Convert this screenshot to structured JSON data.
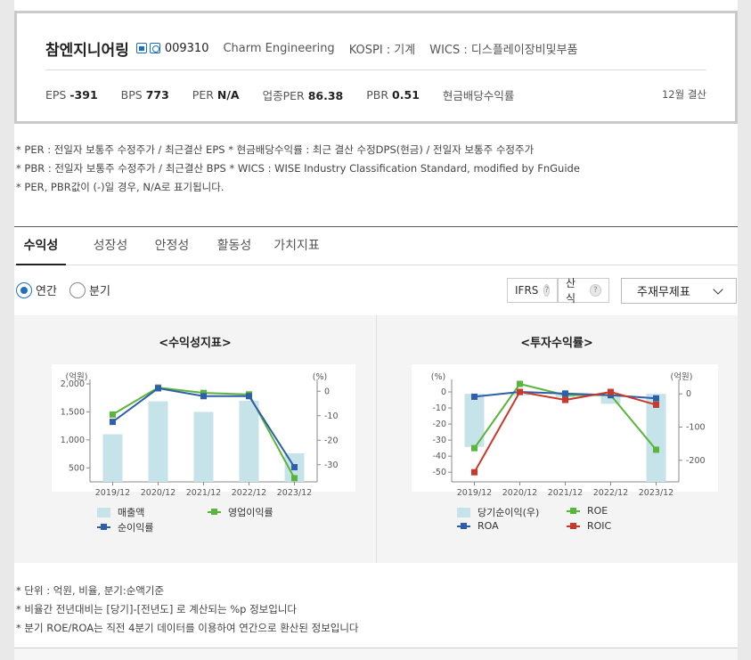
{
  "company": {
    "name": "참엔지니어링",
    "code": "009310",
    "english_name": "Charm Engineering",
    "market": "KOSPI : 기계",
    "wics": "WICS : 디스플레이장비및부품",
    "icons": [
      "home-icon",
      "ir-icon"
    ]
  },
  "metrics": [
    {
      "label": "EPS",
      "value": "-391"
    },
    {
      "label": "BPS",
      "value": "773"
    },
    {
      "label": "PER",
      "value": "N/A"
    },
    {
      "label": "업종PER",
      "value": "86.38"
    },
    {
      "label": "PBR",
      "value": "0.51"
    },
    {
      "label": "현금배당수익률",
      "value": ""
    }
  ],
  "settlement": "12월 결산",
  "notes": [
    "* PER : 전일자 보통주 수정주가 / 최근결산 EPS * 현금배당수익률 : 최근 결산 수정DPS(현금) / 전일자 보통주 수정주가",
    "* PBR : 전일자 보통주 수정주가 / 최근결산 BPS * WICS : WISE Industry Classification Standard, modified by FnGuide",
    "* PER, PBR값이 (-)일 경우, N/A로 표기됩니다."
  ],
  "tabs": [
    "수익성",
    "성장성",
    "안정성",
    "활동성",
    "가치지표"
  ],
  "active_tab": 0,
  "period_options": [
    "연간",
    "분기"
  ],
  "selected_period": "연간",
  "buttons": {
    "ifrs": "IFRS",
    "formula": "산식",
    "help": "?"
  },
  "statement_select": "주재무제표",
  "colors": {
    "bar": "#c7e3ea",
    "green": "#5ab53c",
    "blue": "#2e5fa8",
    "red": "#c8392b",
    "accent": "#1f6fbf"
  },
  "chart_data": [
    {
      "type": "bar+line",
      "title": "<수익성지표>",
      "categories": [
        "2019/12",
        "2020/12",
        "2021/12",
        "2022/12",
        "2023/12"
      ],
      "left_axis": {
        "label": "(억원)",
        "ticks": [
          "2,000",
          "1,500",
          "1,000",
          "500"
        ],
        "ylim": [
          250,
          2000
        ]
      },
      "right_axis": {
        "label": "(%)",
        "ticks": [
          "0",
          "-10",
          "-20",
          "-30"
        ],
        "ylim": [
          -37,
          3
        ]
      },
      "bars": {
        "name": "매출액",
        "axis": "left",
        "values": [
          1100,
          1690,
          1500,
          1700,
          760
        ]
      },
      "series": [
        {
          "name": "영업이익률",
          "axis": "right",
          "color": "#5ab53c",
          "values": [
            -9.5,
            1.5,
            -0.7,
            -1.3,
            -35.5
          ]
        },
        {
          "name": "순이익률",
          "axis": "right",
          "color": "#2e5fa8",
          "values": [
            -12.5,
            1.2,
            -2.0,
            -2.0,
            -31.0
          ]
        }
      ],
      "legend": [
        "매출액",
        "영업이익률",
        "순이익률"
      ]
    },
    {
      "type": "bar+line",
      "title": "<투자수익률>",
      "categories": [
        "2019/12",
        "2020/12",
        "2021/12",
        "2022/12",
        "2023/12"
      ],
      "left_axis": {
        "label": "(%)",
        "ticks": [
          "0",
          "-10",
          "-20",
          "-30",
          "-40",
          "-50"
        ],
        "ylim": [
          -56,
          5
        ]
      },
      "right_axis": {
        "label": "(억원)",
        "ticks": [
          "0",
          "-100",
          "-200"
        ],
        "ylim": [
          -265,
          30
        ]
      },
      "bars": {
        "name": "당기순이익(우)",
        "axis": "right",
        "values": [
          -160,
          -5,
          -10,
          -30,
          -265
        ]
      },
      "series": [
        {
          "name": "ROE",
          "axis": "left",
          "color": "#5ab53c",
          "values": [
            -35,
            5,
            -2,
            -2,
            -36
          ]
        },
        {
          "name": "ROA",
          "axis": "left",
          "color": "#2e5fa8",
          "values": [
            -3,
            0,
            -1,
            -2,
            -4
          ]
        },
        {
          "name": "ROIC",
          "axis": "left",
          "color": "#c8392b",
          "values": [
            -50,
            0,
            -5,
            0,
            -8
          ]
        }
      ],
      "legend": [
        "당기순이익(우)",
        "ROE",
        "ROA",
        "ROIC"
      ]
    }
  ],
  "footer_notes": [
    "* 단위 : 억원, 비율, 분기:순액기준",
    "* 비율간 전년대비는 [당기]-[전년도] 로 계산되는 %p 정보입니다",
    "* 분기 ROE/ROA는 직전 4분기 데이터를 이용하여 연간으로 환산된 정보입니다"
  ]
}
